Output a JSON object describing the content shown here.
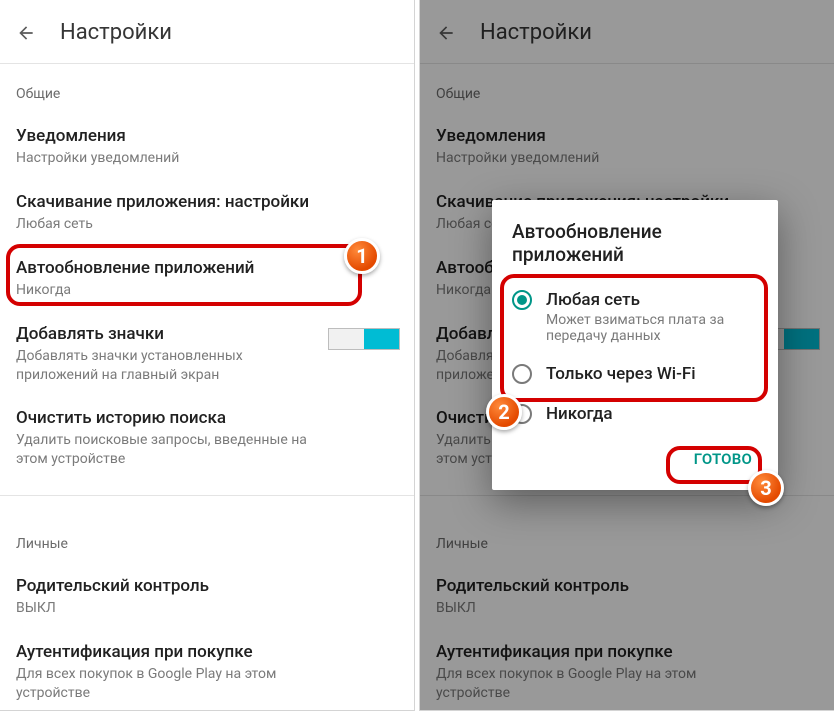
{
  "header_title": "Настройки",
  "sections": {
    "general": "Общие",
    "personal": "Личные"
  },
  "items": {
    "notifications": {
      "title": "Уведомления",
      "sub": "Настройки уведомлений"
    },
    "download": {
      "title": "Скачивание приложения: настройки",
      "sub": "Любая сеть"
    },
    "autoupdate": {
      "title": "Автообновление приложений",
      "sub": "Никогда"
    },
    "add_icons": {
      "title": "Добавлять значки",
      "sub": "Добавлять значки установленных приложений на главный экран"
    },
    "clear_history": {
      "title": "Очистить историю поиска",
      "sub": "Удалить поисковые запросы, введенные на этом устройстве"
    },
    "parental": {
      "title": "Родительский контроль",
      "sub": "ВЫКЛ"
    },
    "auth": {
      "title": "Аутентификация при покупке",
      "sub": "Для всех покупок в Google Play на этом устройстве"
    }
  },
  "dialog": {
    "title": "Автообновление приложений",
    "options": {
      "any": {
        "label": "Любая сеть",
        "sub": "Может взиматься плата за передачу данных"
      },
      "wifi": {
        "label": "Только через Wi-Fi"
      },
      "never": {
        "label": "Никогда"
      }
    },
    "done": "ГОТОВО"
  },
  "badges": {
    "b1": "1",
    "b2": "2",
    "b3": "3"
  }
}
